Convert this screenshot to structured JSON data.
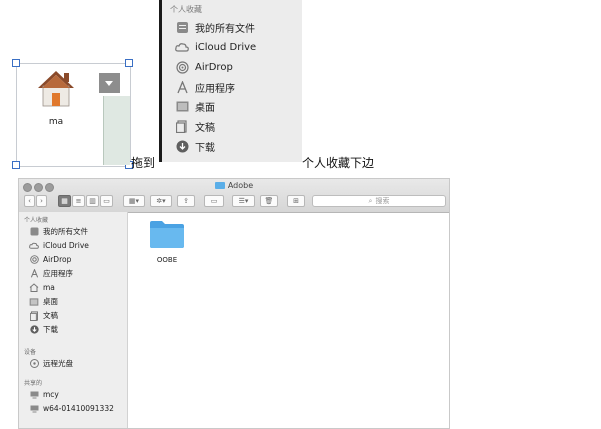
{
  "selected_item": {
    "label": "ma"
  },
  "favorites_panel": {
    "header": "个人收藏",
    "items": [
      {
        "label": "我的所有文件",
        "icon": "all-files-icon"
      },
      {
        "label": "iCloud Drive",
        "icon": "cloud-icon"
      },
      {
        "label": "AirDrop",
        "icon": "airdrop-icon"
      },
      {
        "label": "应用程序",
        "icon": "applications-icon"
      },
      {
        "label": "桌面",
        "icon": "desktop-icon"
      },
      {
        "label": "文稿",
        "icon": "documents-icon"
      },
      {
        "label": "下载",
        "icon": "downloads-icon"
      }
    ]
  },
  "instruction": {
    "left": "拖到",
    "right": "个人收藏下边"
  },
  "finder": {
    "title": "Adobe",
    "search_placeholder": "搜索",
    "sidebar": {
      "favorites_header": "个人收藏",
      "favorites": [
        {
          "label": "我的所有文件",
          "icon": "all-files-icon"
        },
        {
          "label": "iCloud Drive",
          "icon": "cloud-icon"
        },
        {
          "label": "AirDrop",
          "icon": "airdrop-icon"
        },
        {
          "label": "应用程序",
          "icon": "applications-icon"
        },
        {
          "label": "ma",
          "icon": "home-icon"
        },
        {
          "label": "桌面",
          "icon": "desktop-icon"
        },
        {
          "label": "文稿",
          "icon": "documents-icon"
        },
        {
          "label": "下载",
          "icon": "downloads-icon"
        }
      ],
      "devices_header": "设备",
      "devices": [
        {
          "label": "远程光盘",
          "icon": "disc-icon"
        }
      ],
      "shared_header": "共享的",
      "shared": [
        {
          "label": "mcy",
          "icon": "computer-icon"
        },
        {
          "label": "w64-01410091332",
          "icon": "computer-icon"
        }
      ]
    },
    "content": [
      {
        "label": "OOBE",
        "icon": "folder-icon"
      }
    ]
  },
  "colors": {
    "folder_blue": "#5aaee8",
    "selection_handle": "#3a6fc4",
    "home_roof": "#8a4a2a",
    "home_door": "#e0782c"
  }
}
